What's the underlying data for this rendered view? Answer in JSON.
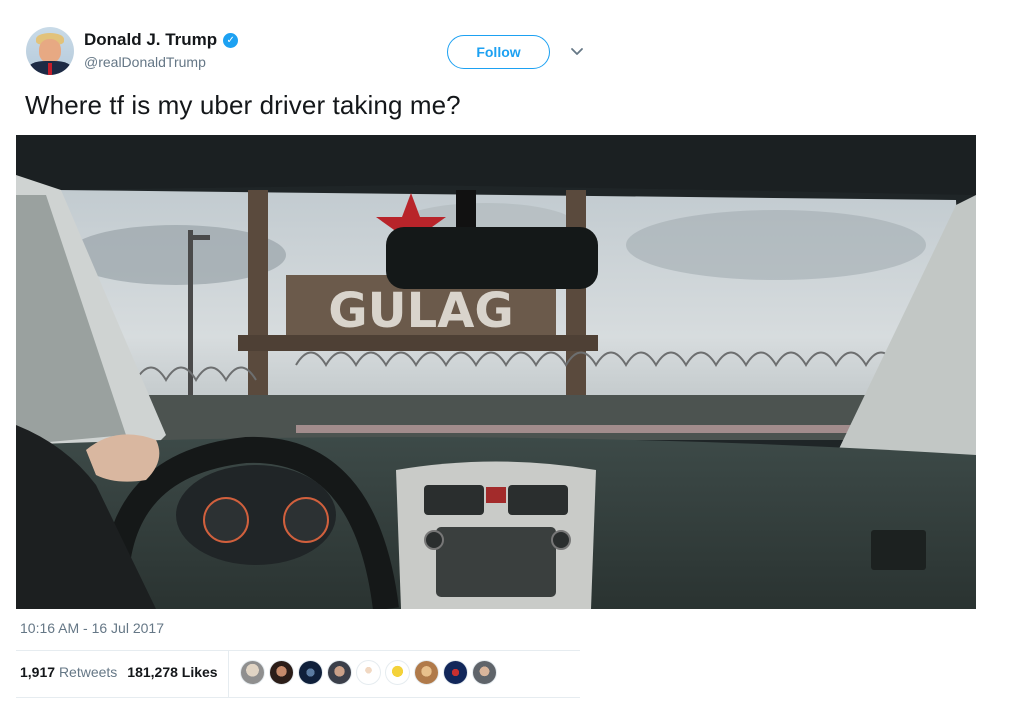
{
  "author": {
    "display_name": "Donald J. Trump",
    "handle": "@realDonaldTrump",
    "verified_icon": "verified-badge-icon"
  },
  "follow_button": {
    "label": "Follow"
  },
  "menu_icon": "chevron-down-icon",
  "tweet": {
    "text": "Where tf is my uber driver taking me?",
    "timestamp": "10:16 AM - 16 Jul 2017"
  },
  "media": {
    "alt_icon": "photo",
    "sign_text": "GULAG"
  },
  "stats": {
    "retweets_count": "1,917",
    "retweets_label": "Retweets",
    "likes_count": "181,278",
    "likes_label": "Likes"
  },
  "likers": [
    "liker-1",
    "liker-2",
    "liker-3",
    "liker-4",
    "liker-5",
    "liker-6",
    "liker-7",
    "liker-8",
    "liker-9"
  ],
  "colors": {
    "accent": "#1da1f2",
    "secondary_text": "#657786",
    "primary_text": "#14171a"
  }
}
